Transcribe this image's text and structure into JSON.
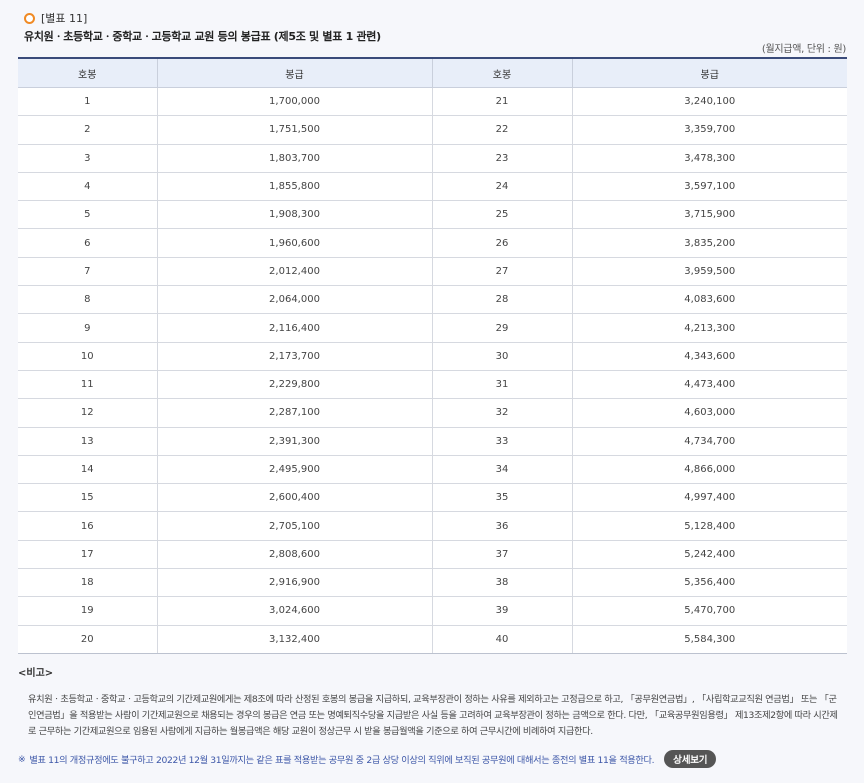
{
  "header": {
    "tag": "[별표 11]",
    "title": "유치원ㆍ초등학교ㆍ중학교ㆍ고등학교 교원 등의 봉급표 (제5조 및 별표 1 관련)"
  },
  "unit_note": "(월지급액, 단위 : 원)",
  "table": {
    "headers": [
      "호봉",
      "봉급",
      "호봉",
      "봉급"
    ],
    "rows": [
      [
        "1",
        "1,700,000",
        "21",
        "3,240,100"
      ],
      [
        "2",
        "1,751,500",
        "22",
        "3,359,700"
      ],
      [
        "3",
        "1,803,700",
        "23",
        "3,478,300"
      ],
      [
        "4",
        "1,855,800",
        "24",
        "3,597,100"
      ],
      [
        "5",
        "1,908,300",
        "25",
        "3,715,900"
      ],
      [
        "6",
        "1,960,600",
        "26",
        "3,835,200"
      ],
      [
        "7",
        "2,012,400",
        "27",
        "3,959,500"
      ],
      [
        "8",
        "2,064,000",
        "28",
        "4,083,600"
      ],
      [
        "9",
        "2,116,400",
        "29",
        "4,213,300"
      ],
      [
        "10",
        "2,173,700",
        "30",
        "4,343,600"
      ],
      [
        "11",
        "2,229,800",
        "31",
        "4,473,400"
      ],
      [
        "12",
        "2,287,100",
        "32",
        "4,603,000"
      ],
      [
        "13",
        "2,391,300",
        "33",
        "4,734,700"
      ],
      [
        "14",
        "2,495,900",
        "34",
        "4,866,000"
      ],
      [
        "15",
        "2,600,400",
        "35",
        "4,997,400"
      ],
      [
        "16",
        "2,705,100",
        "36",
        "5,128,400"
      ],
      [
        "17",
        "2,808,600",
        "37",
        "5,242,400"
      ],
      [
        "18",
        "2,916,900",
        "38",
        "5,356,400"
      ],
      [
        "19",
        "3,024,600",
        "39",
        "5,470,700"
      ],
      [
        "20",
        "3,132,400",
        "40",
        "5,584,300"
      ]
    ]
  },
  "remarks": {
    "title": "<비고>",
    "body": "유치원ㆍ초등학교ㆍ중학교ㆍ고등학교의 기간제교원에게는 제8조에 따라 산정된 호봉의 봉급을 지급하되, 교육부장관이 정하는 사유를 제외하고는 고정급으로 하고, 「공무원연금법」, 「사립학교교직원 연금법」 또는 「군인연금법」을 적용받는 사람이 기간제교원으로 채용되는 경우의 봉급은 연금 또는 명예퇴직수당을 지급받은 사실 등을 고려하여 교육부장관이 정하는 금액으로 한다. 다만, 「교육공무원임용령」 제13조제2항에 따라 시간제로 근무하는 기간제교원으로 임용된 사람에게 지급하는 월봉급액은 해당 교원이 정상근무 시 받을 봉급월액을 기준으로 하여 근무시간에 비례하여 지급한다."
  },
  "note": {
    "mark": "※",
    "text": "별표 11의 개정규정에도 불구하고 2022년 12월 31일까지는 같은 표를 적용받는 공무원 중 2급 상당 이상의 직위에 보직된 공무원에 대해서는 종전의 별표 11을 적용한다.",
    "button_label": "상세보기"
  },
  "colors": {
    "accent_orange": "#f08a24",
    "header_bg": "#e8eef9",
    "note_blue": "#3d57a8"
  }
}
